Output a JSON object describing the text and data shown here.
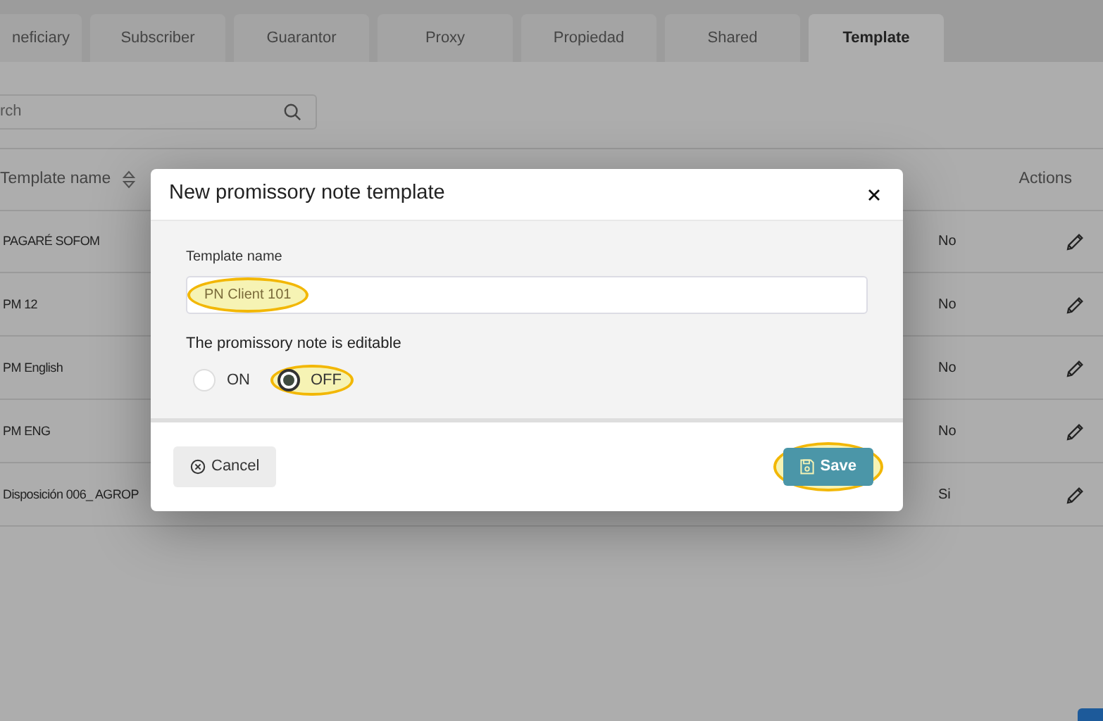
{
  "tabs": [
    {
      "label": "neficiary",
      "selected": false
    },
    {
      "label": "Subscriber",
      "selected": false
    },
    {
      "label": "Guarantor",
      "selected": false
    },
    {
      "label": "Proxy",
      "selected": false
    },
    {
      "label": "Propiedad",
      "selected": false
    },
    {
      "label": "Shared",
      "selected": false
    },
    {
      "label": "Template",
      "selected": true
    }
  ],
  "search": {
    "placeholder": "rch"
  },
  "table": {
    "columns": [
      {
        "label": "Template name",
        "sortable": true
      },
      {
        "label": "Actions",
        "sortable": false
      }
    ],
    "rows": [
      {
        "name": "PAGARÉ SOFOM",
        "editable": "No"
      },
      {
        "name": "PM 12",
        "editable": "No"
      },
      {
        "name": "PM English",
        "editable": "No"
      },
      {
        "name": "PM ENG",
        "editable": "No"
      },
      {
        "name": "Disposición 006_ AGROP",
        "editable": "Si"
      }
    ]
  },
  "modal": {
    "title": "New promissory note template",
    "field_label": "Template name",
    "field_value": "PN Client 101",
    "value_highlighted": true,
    "question": "The promissory note is editable",
    "options": [
      {
        "label": "ON",
        "selected": false,
        "highlighted": false
      },
      {
        "label": "OFF",
        "selected": true,
        "highlighted": true
      }
    ],
    "buttons": [
      {
        "kind": "cancel",
        "label": "Cancel",
        "highlighted": false
      },
      {
        "kind": "save",
        "label": "Save",
        "highlighted": true
      }
    ]
  }
}
